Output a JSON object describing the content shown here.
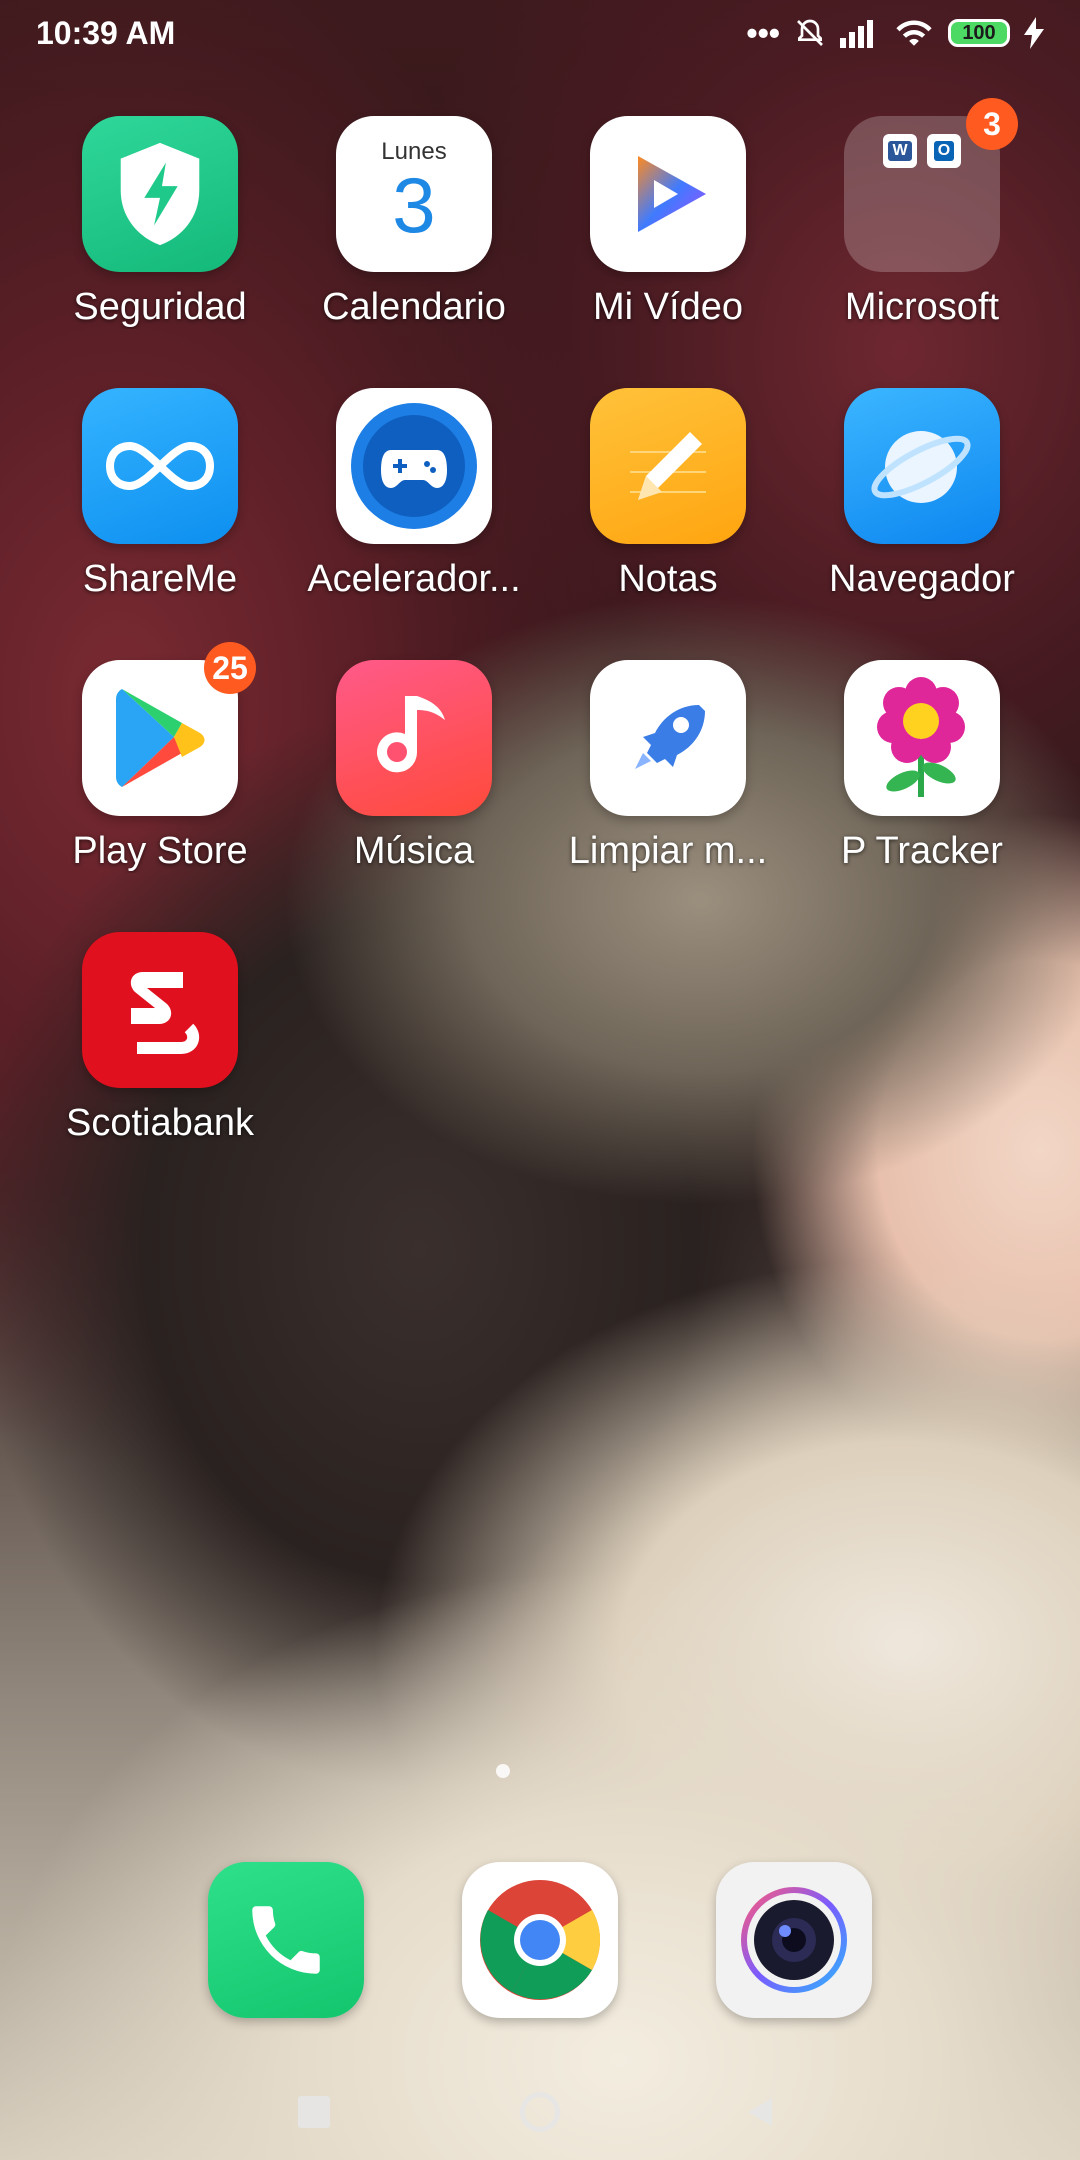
{
  "status_bar": {
    "time": "10:39 AM",
    "battery_level": "100",
    "icons": [
      "dots-icon",
      "bell-muted-icon",
      "signal-icon",
      "wifi-icon",
      "battery-icon",
      "charging-icon"
    ]
  },
  "apps": [
    {
      "label": "Seguridad",
      "icon": "shield-bolt-icon",
      "color": "#1fc98a"
    },
    {
      "label": "Calendario",
      "icon": "calendar-icon",
      "day_name": "Lunes",
      "day_number": "3",
      "color": "#ffffff"
    },
    {
      "label": "Mi Vídeo",
      "icon": "play-icon",
      "color": "#ffffff"
    },
    {
      "label": "Microsoft",
      "icon": "folder-icon",
      "badge": "3",
      "folder_items": [
        "W",
        "O"
      ]
    },
    {
      "label": "ShareMe",
      "icon": "infinity-icon",
      "color": "#1fa3ff"
    },
    {
      "label": "Acelerador...",
      "icon": "gamepad-icon",
      "color": "#ffffff"
    },
    {
      "label": "Notas",
      "icon": "pencil-icon",
      "color": "#ffb21f"
    },
    {
      "label": "Navegador",
      "icon": "planet-icon",
      "color": "#1ea0ff"
    },
    {
      "label": "Play Store",
      "icon": "play-store-icon",
      "badge": "25",
      "color": "#ffffff"
    },
    {
      "label": "Música",
      "icon": "music-note-icon",
      "color": "#ff4d6a"
    },
    {
      "label": "Limpiar m...",
      "icon": "rocket-icon",
      "color": "#ffffff"
    },
    {
      "label": "P Tracker",
      "icon": "flower-icon",
      "color": "#ffffff"
    },
    {
      "label": "Scotiabank",
      "icon": "scotiabank-icon",
      "color": "#e0101e"
    }
  ],
  "dock": [
    {
      "name": "phone",
      "icon": "phone-icon",
      "color": "#20d57d"
    },
    {
      "name": "chrome",
      "icon": "chrome-icon",
      "color": "#ffffff"
    },
    {
      "name": "camera",
      "icon": "camera-icon",
      "color": "#f2f2f2"
    }
  ],
  "nav": {
    "icons": [
      "recents-square-icon",
      "home-circle-icon",
      "back-triangle-icon"
    ]
  }
}
